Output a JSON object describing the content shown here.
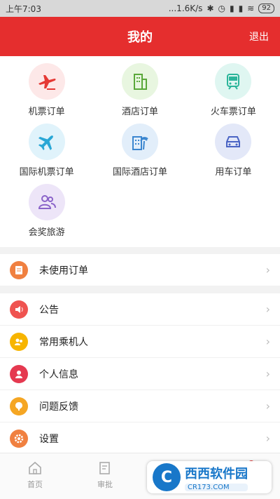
{
  "status_bar": {
    "time": "上午7:03",
    "net_speed": "...1.6K/s",
    "icons": [
      "bluetooth-icon",
      "alarm-icon",
      "signal-icon",
      "signal-icon",
      "wifi-icon"
    ],
    "battery": "92"
  },
  "header": {
    "title": "我的",
    "logout": "退出"
  },
  "grid": [
    {
      "label": "机票订单",
      "icon": "plane-icon",
      "bg": "#fde8e8",
      "fg": "#e53935"
    },
    {
      "label": "酒店订单",
      "icon": "building-icon",
      "bg": "#e8f6e0",
      "fg": "#5aa83a"
    },
    {
      "label": "火车票订单",
      "icon": "train-icon",
      "bg": "#dff6f1",
      "fg": "#2bb59a"
    },
    {
      "label": "国际机票订单",
      "icon": "airplane-icon",
      "bg": "#e0f3fb",
      "fg": "#29a7d6"
    },
    {
      "label": "国际酒店订单",
      "icon": "resort-icon",
      "bg": "#e2eefa",
      "fg": "#3b86cf"
    },
    {
      "label": "用车订单",
      "icon": "car-icon",
      "bg": "#e3e8f8",
      "fg": "#4a64c4"
    },
    {
      "label": "会奖旅游",
      "icon": "group-icon",
      "bg": "#ede5f8",
      "fg": "#8a63c9"
    }
  ],
  "menu_top": [
    {
      "label": "未使用订单",
      "icon": "order-icon",
      "color": "#f08040"
    }
  ],
  "menu_main": [
    {
      "label": "公告",
      "icon": "speaker-icon",
      "color": "#ef5350"
    },
    {
      "label": "常用乘机人",
      "icon": "passenger-icon",
      "color": "#f7b500"
    },
    {
      "label": "个人信息",
      "icon": "person-icon",
      "color": "#e53950"
    },
    {
      "label": "问题反馈",
      "icon": "feedback-icon",
      "color": "#f5a623"
    },
    {
      "label": "设置",
      "icon": "gear-icon",
      "color": "#f08040"
    }
  ],
  "tabs": [
    {
      "label": "首页",
      "icon": "home-icon"
    },
    {
      "label": "审批",
      "icon": "approval-icon"
    },
    {
      "label": "",
      "icon": "location-icon"
    },
    {
      "label": "",
      "icon": "profile-icon"
    }
  ],
  "watermark": {
    "logo": "C",
    "main": "西西软件园",
    "url": "CR173.COM"
  }
}
